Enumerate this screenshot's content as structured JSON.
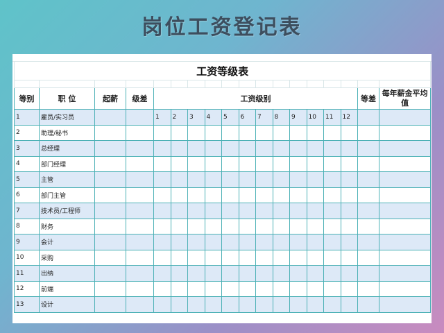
{
  "banner_title": "岗位工资登记表",
  "table_title": "工资等级表",
  "headers": {
    "grade": "等别",
    "position": "职 位",
    "starting_pay": "起薪",
    "step_diff": "级差",
    "pay_level": "工资级别",
    "grade_diff": "等差",
    "annual_avg": "每年薪金平均值"
  },
  "levels": [
    "1",
    "2",
    "3",
    "4",
    "5",
    "6",
    "7",
    "8",
    "9",
    "10",
    "11",
    "12"
  ],
  "rows": [
    {
      "grade": "1",
      "position": "雇员/实习员"
    },
    {
      "grade": "2",
      "position": "助理/秘书"
    },
    {
      "grade": "3",
      "position": "总经理"
    },
    {
      "grade": "4",
      "position": "部门经理"
    },
    {
      "grade": "5",
      "position": "主管"
    },
    {
      "grade": "6",
      "position": "部门主管"
    },
    {
      "grade": "7",
      "position": "技术员/工程师"
    },
    {
      "grade": "8",
      "position": "财务"
    },
    {
      "grade": "9",
      "position": "会计"
    },
    {
      "grade": "10",
      "position": "采购"
    },
    {
      "grade": "11",
      "position": "出纳"
    },
    {
      "grade": "12",
      "position": "前端"
    },
    {
      "grade": "13",
      "position": "设计"
    }
  ],
  "colors": {
    "border": "#4ab0b5",
    "row_shade": "#dde9f7",
    "banner_text": "#3d4e5e"
  }
}
